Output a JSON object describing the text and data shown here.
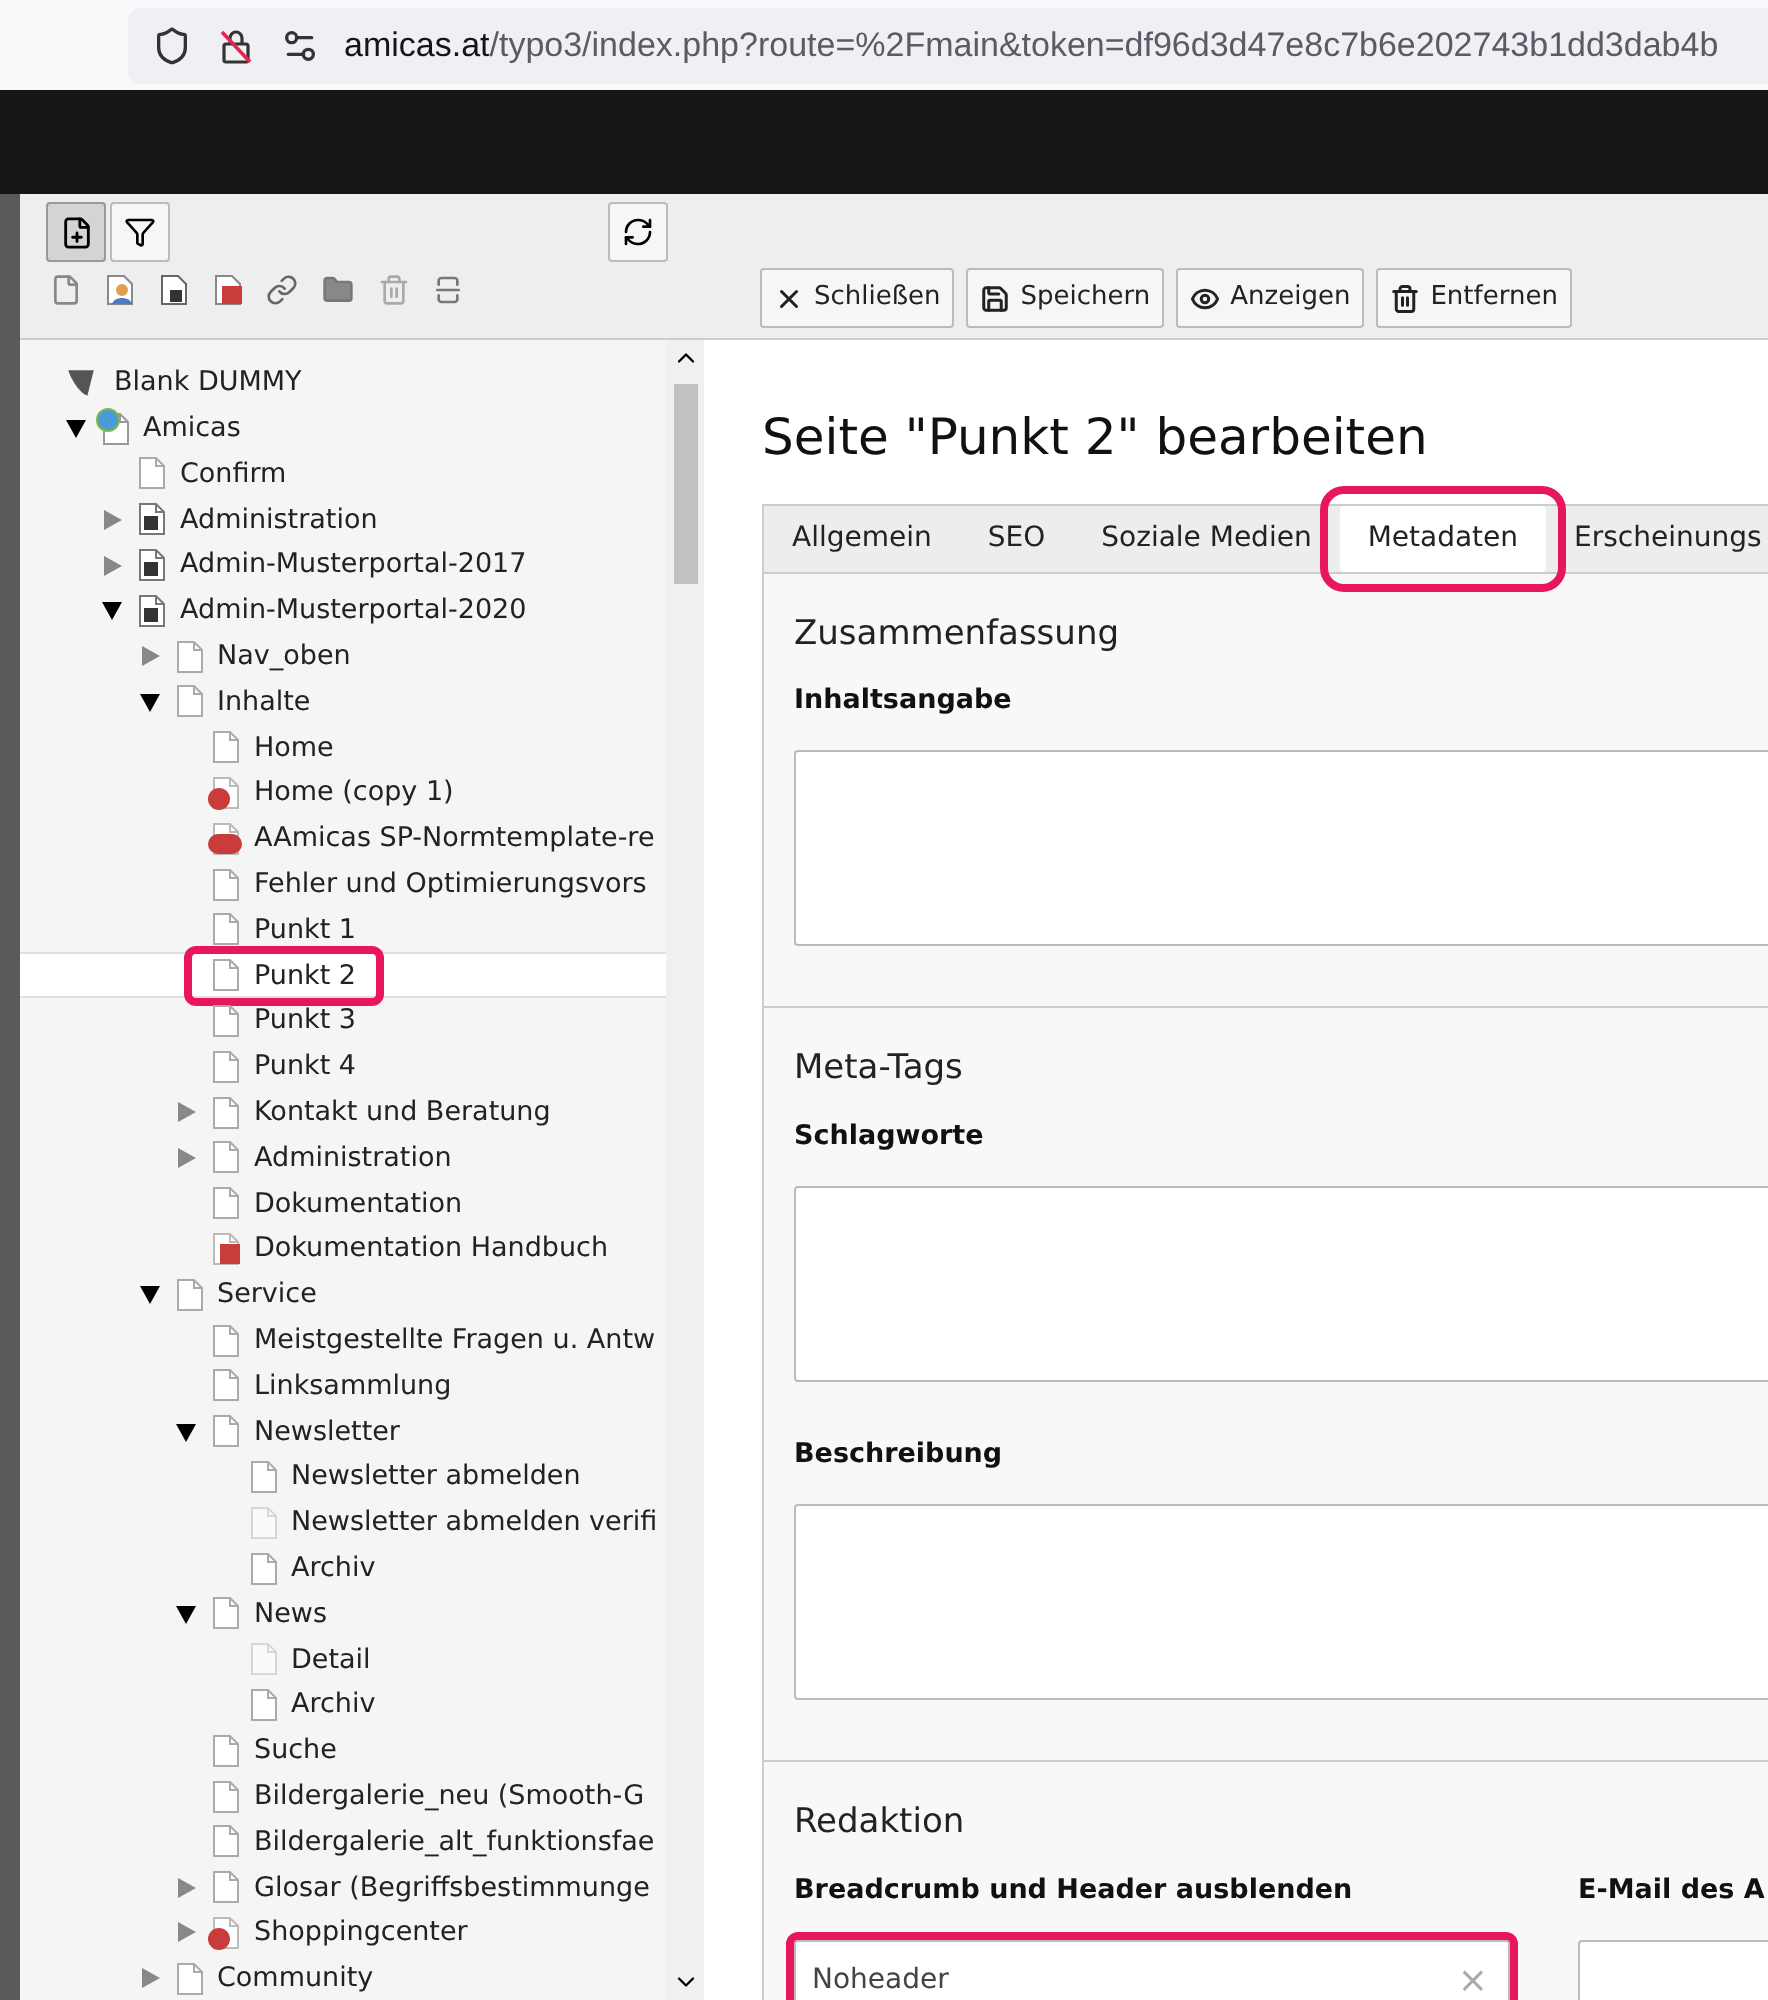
{
  "address_bar": {
    "host": "amicas.at",
    "path": "/typo3/index.php?route=%2Fmain&token=df96d3d47e8c7b6e202743b1dd3dab4b"
  },
  "tree_toolbar": {
    "new_page_active": true
  },
  "tree": [
    {
      "label": "Blank DUMMY",
      "kind": "root",
      "children": [
        {
          "label": "Amicas",
          "kind": "site",
          "expanded": true,
          "children": [
            {
              "label": "Confirm",
              "kind": "page"
            },
            {
              "label": "Administration",
              "kind": "shortcut",
              "expanded": false
            },
            {
              "label": "Admin-Musterportal-2017",
              "kind": "shortcut",
              "expanded": false
            },
            {
              "label": "Admin-Musterportal-2020",
              "kind": "shortcut",
              "expanded": true,
              "children": [
                {
                  "label": "Nav_oben",
                  "kind": "page",
                  "expanded": false
                },
                {
                  "label": "Inhalte",
                  "kind": "page",
                  "expanded": true,
                  "children": [
                    {
                      "label": "Home",
                      "kind": "page"
                    },
                    {
                      "label": "Home (copy 1)",
                      "kind": "hidden"
                    },
                    {
                      "label": "AAmicas SP-Normtemplate-re",
                      "kind": "restricted"
                    },
                    {
                      "label": "Fehler und Optimierungsvors",
                      "kind": "page"
                    },
                    {
                      "label": "Punkt 1",
                      "kind": "page"
                    },
                    {
                      "label": "Punkt 2",
                      "kind": "page",
                      "selected": true,
                      "highlighted": true
                    },
                    {
                      "label": "Punkt 3",
                      "kind": "page"
                    },
                    {
                      "label": "Punkt 4",
                      "kind": "page"
                    },
                    {
                      "label": "Kontakt und Beratung",
                      "kind": "page",
                      "expanded": false
                    },
                    {
                      "label": "Administration",
                      "kind": "page",
                      "expanded": false
                    },
                    {
                      "label": "Dokumentation",
                      "kind": "page"
                    },
                    {
                      "label": "Dokumentation Handbuch",
                      "kind": "external"
                    }
                  ]
                },
                {
                  "label": "Service",
                  "kind": "page",
                  "expanded": true,
                  "children": [
                    {
                      "label": "Meistgestellte Fragen u. Antw",
                      "kind": "page"
                    },
                    {
                      "label": "Linksammlung",
                      "kind": "page"
                    },
                    {
                      "label": "Newsletter",
                      "kind": "page",
                      "expanded": true,
                      "children": [
                        {
                          "label": "Newsletter abmelden",
                          "kind": "page"
                        },
                        {
                          "label": "Newsletter abmelden verifi",
                          "kind": "faded"
                        },
                        {
                          "label": "Archiv",
                          "kind": "page"
                        }
                      ]
                    },
                    {
                      "label": "News",
                      "kind": "page",
                      "expanded": true,
                      "children": [
                        {
                          "label": "Detail",
                          "kind": "faded"
                        },
                        {
                          "label": "Archiv",
                          "kind": "page"
                        }
                      ]
                    },
                    {
                      "label": "Suche",
                      "kind": "page"
                    },
                    {
                      "label": "Bildergalerie_neu (Smooth-G",
                      "kind": "page"
                    },
                    {
                      "label": "Bildergalerie_alt_funktionsfae",
                      "kind": "page"
                    },
                    {
                      "label": "Glosar (Begriffsbestimmunge",
                      "kind": "page",
                      "expanded": false
                    },
                    {
                      "label": "Shoppingcenter",
                      "kind": "hidden",
                      "expanded": false
                    }
                  ]
                },
                {
                  "label": "Community",
                  "kind": "page",
                  "expanded": false
                }
              ]
            }
          ]
        }
      ]
    }
  ],
  "actions": [
    {
      "label": "Schließen",
      "kind": "close"
    },
    {
      "label": "Speichern",
      "kind": "save"
    },
    {
      "label": "Anzeigen",
      "kind": "view"
    },
    {
      "label": "Entfernen",
      "kind": "delete"
    }
  ],
  "title": "Seite \"Punkt 2\" bearbeiten",
  "tabs": [
    {
      "label": "Allgemein",
      "selected": false,
      "highlighted": false
    },
    {
      "label": "SEO",
      "selected": false,
      "highlighted": false
    },
    {
      "label": "Soziale Medien",
      "selected": false,
      "highlighted": false
    },
    {
      "label": "Metadaten",
      "selected": true,
      "highlighted": true
    },
    {
      "label": "Erscheinungs",
      "selected": false,
      "highlighted": false
    }
  ],
  "sections": [
    {
      "heading": "Zusammenfassung",
      "fields": [
        {
          "label": "Inhaltsangabe",
          "kind": "textarea"
        }
      ]
    },
    {
      "heading": "Meta-Tags",
      "fields": [
        {
          "label": "Schlagworte",
          "kind": "textarea"
        },
        {
          "label": "Beschreibung",
          "kind": "textarea"
        }
      ]
    },
    {
      "heading": "Redaktion",
      "fields": [
        {
          "label": "Breadcrumb und Header ausblenden",
          "kind": "select",
          "value": "Noheader",
          "highlighted": true,
          "clear": "×"
        },
        {
          "label": "E-Mail des A",
          "kind": "input"
        }
      ]
    }
  ]
}
